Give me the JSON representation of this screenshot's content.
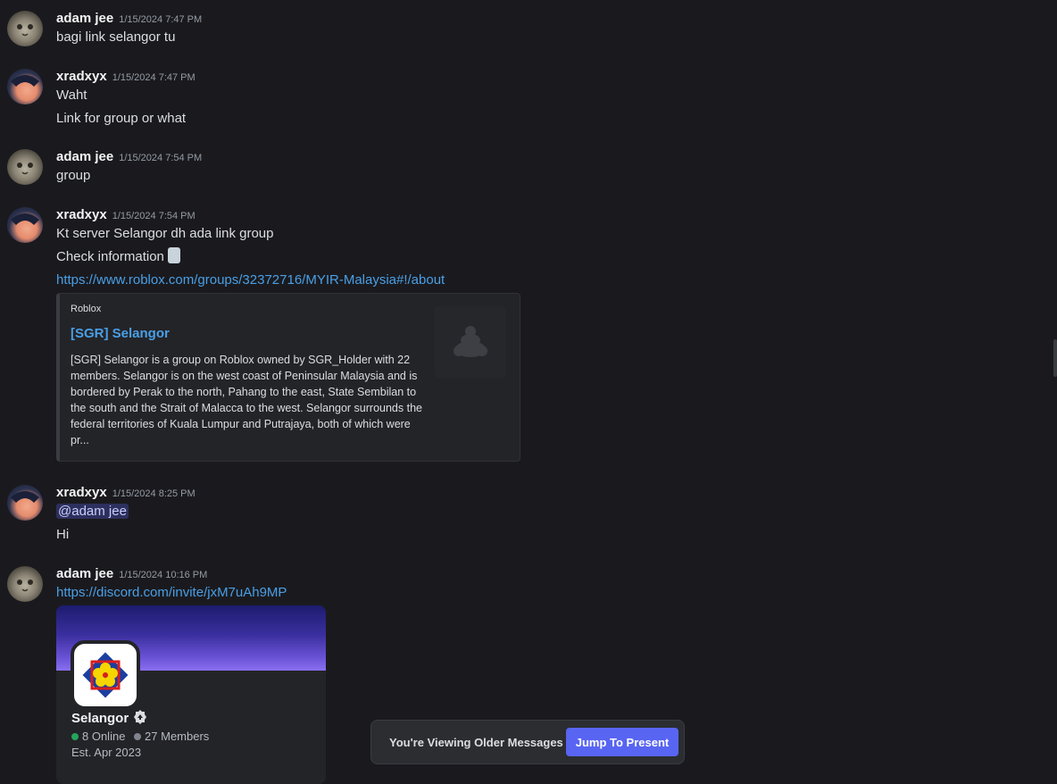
{
  "messages": [
    {
      "user": "adam jee",
      "time": "1/15/2024 7:47 PM",
      "lines": [
        "bagi link selangor tu"
      ]
    },
    {
      "user": "xradxyx",
      "time": "1/15/2024 7:47 PM",
      "lines": [
        "Waht",
        "Link for group or what"
      ]
    },
    {
      "user": "adam jee",
      "time": "1/15/2024 7:54 PM",
      "lines": [
        "group"
      ]
    },
    {
      "user": "xradxyx",
      "time": "1/15/2024 7:54 PM",
      "lines": [
        "Kt server Selangor dh ada link group",
        "Check information"
      ],
      "link": "https://www.roblox.com/groups/32372716/MYIR-Malaysia#!/about"
    },
    {
      "user": "xradxyx",
      "time": "1/15/2024 8:25 PM",
      "mention": "@adam jee",
      "lines": [
        "Hi"
      ]
    },
    {
      "user": "adam jee",
      "time": "1/15/2024 10:16 PM",
      "link": "https://discord.com/invite/jxM7uAh9MP"
    }
  ],
  "embed": {
    "provider": "Roblox",
    "title": "[SGR] Selangor",
    "description": "[SGR] Selangor is a group on Roblox owned by SGR_Holder with 22 members. Selangor is on the west coast of Peninsular Malaysia and is bordered by Perak to the north, Pahang to the east, State Sembilan to the south and the Strait of Malacca to the west. Selangor surrounds the federal territories of Kuala Lumpur and Putrajaya, both of which were pr..."
  },
  "invite": {
    "name": "Selangor",
    "online": "8 Online",
    "members": "27 Members",
    "established": "Est. Apr 2023"
  },
  "older_bar": {
    "text": "You're Viewing Older Messages",
    "button": "Jump To Present"
  },
  "colors": {
    "background": "#1a1a1e",
    "link": "#4a9fe6",
    "accent": "#5865f2",
    "online": "#23a55a",
    "offline": "#80848e"
  }
}
